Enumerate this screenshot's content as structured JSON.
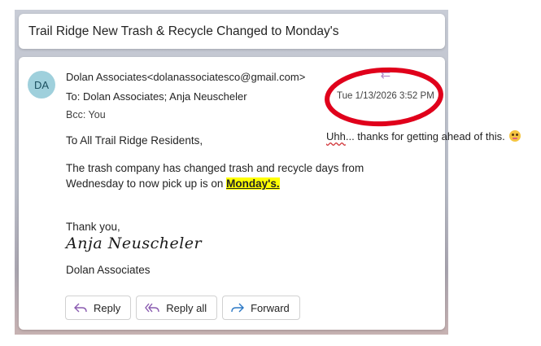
{
  "subject": "Trail Ridge New Trash & Recycle Changed to Monday's",
  "message": {
    "avatar_initials": "DA",
    "from": "Dolan Associates<dolanassociatesco@gmail.com>",
    "to": "To:  Dolan Associates;   Anja Neuscheler",
    "bcc": "Bcc:  You",
    "date": "Tue 1/13/2026 3:52 PM",
    "greeting": "To All Trail Ridge Residents,",
    "paragraph": "The trash company has changed trash and recycle days from Wednesday to now pick up is on ",
    "highlight": "Monday's.",
    "closing": "Thank you,",
    "signature": "Anja Neuscheler",
    "company": "Dolan Associates"
  },
  "actions": {
    "reply": "Reply",
    "reply_all": "Reply all",
    "forward": "Forward"
  },
  "annotation": {
    "word": "Uhh",
    "rest": "... thanks for getting ahead of this."
  },
  "colors": {
    "circle": "#e0001b",
    "highlight": "#ffff00",
    "avatar": "#9fd0dc"
  }
}
